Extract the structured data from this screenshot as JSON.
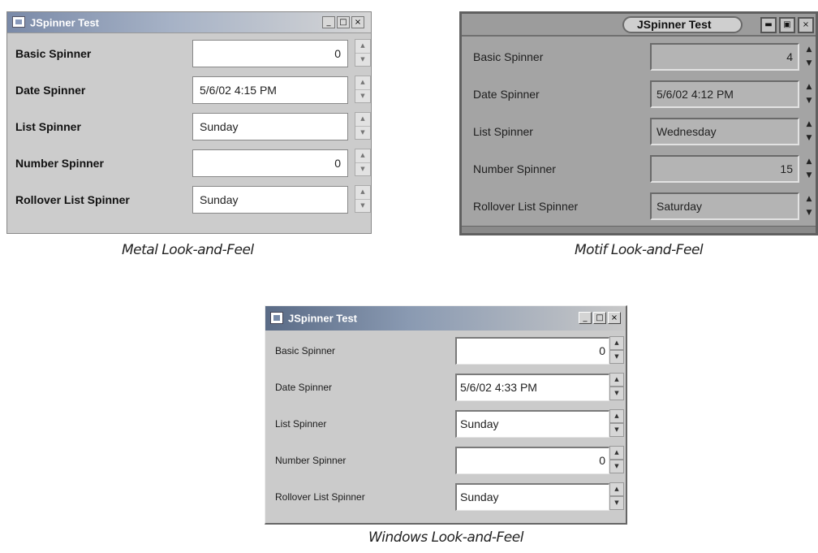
{
  "metal": {
    "title": "JSpinner Test",
    "caption": "Metal Look-and-Feel",
    "buttons": [
      "_",
      "□",
      "×"
    ],
    "rows": [
      {
        "label": "Basic Spinner",
        "value": "0",
        "align": "right"
      },
      {
        "label": "Date Spinner",
        "value": "5/6/02 4:15 PM",
        "align": "left"
      },
      {
        "label": "List Spinner",
        "value": "Sunday",
        "align": "left"
      },
      {
        "label": "Number Spinner",
        "value": "0",
        "align": "right"
      },
      {
        "label": "Rollover List Spinner",
        "value": "Sunday",
        "align": "left"
      }
    ]
  },
  "motif": {
    "title": "JSpinner Test",
    "caption": "Motif Look-and-Feel",
    "buttons": [
      "▬",
      "▣",
      "×"
    ],
    "rows": [
      {
        "label": "Basic Spinner",
        "value": "4",
        "align": "right"
      },
      {
        "label": "Date Spinner",
        "value": "5/6/02 4:12 PM",
        "align": "left"
      },
      {
        "label": "List Spinner",
        "value": "Wednesday",
        "align": "left"
      },
      {
        "label": "Number Spinner",
        "value": "15",
        "align": "right"
      },
      {
        "label": "Rollover List Spinner",
        "value": "Saturday",
        "align": "left"
      }
    ]
  },
  "windows": {
    "title": "JSpinner Test",
    "caption": "Windows Look-and-Feel",
    "buttons": [
      "_",
      "□",
      "×"
    ],
    "rows": [
      {
        "label": "Basic Spinner",
        "value": "0",
        "align": "right"
      },
      {
        "label": "Date Spinner",
        "value": "5/6/02 4:33 PM",
        "align": "left"
      },
      {
        "label": "List Spinner",
        "value": "Sunday",
        "align": "left"
      },
      {
        "label": "Number Spinner",
        "value": "0",
        "align": "right"
      },
      {
        "label": "Rollover List Spinner",
        "value": "Sunday",
        "align": "left"
      }
    ]
  },
  "icons": {
    "spinner_up": "▲",
    "spinner_down": "▼"
  }
}
